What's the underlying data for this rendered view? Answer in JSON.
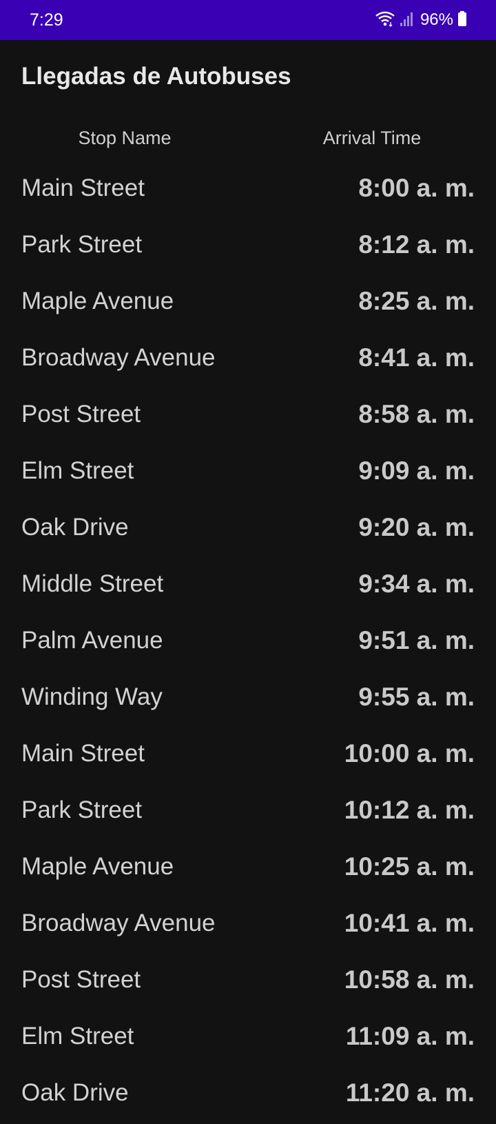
{
  "status_bar": {
    "time": "7:29",
    "battery": "96%",
    "icons": [
      "wifi-icon",
      "signal-icon",
      "battery-icon"
    ]
  },
  "app_bar": {
    "title": "Llegadas de Autobuses"
  },
  "table": {
    "headers": {
      "stop": "Stop Name",
      "arrival": "Arrival Time"
    },
    "rows": [
      {
        "stop": "Main Street",
        "time": "8:00 a. m."
      },
      {
        "stop": "Park Street",
        "time": "8:12 a. m."
      },
      {
        "stop": "Maple Avenue",
        "time": "8:25 a. m."
      },
      {
        "stop": "Broadway Avenue",
        "time": "8:41 a. m."
      },
      {
        "stop": "Post Street",
        "time": "8:58 a. m."
      },
      {
        "stop": "Elm Street",
        "time": "9:09 a. m."
      },
      {
        "stop": "Oak Drive",
        "time": "9:20 a. m."
      },
      {
        "stop": "Middle Street",
        "time": "9:34 a. m."
      },
      {
        "stop": "Palm Avenue",
        "time": "9:51 a. m."
      },
      {
        "stop": "Winding Way",
        "time": "9:55 a. m."
      },
      {
        "stop": "Main Street",
        "time": "10:00 a. m."
      },
      {
        "stop": "Park Street",
        "time": "10:12 a. m."
      },
      {
        "stop": "Maple Avenue",
        "time": "10:25 a. m."
      },
      {
        "stop": "Broadway Avenue",
        "time": "10:41 a. m."
      },
      {
        "stop": "Post Street",
        "time": "10:58 a. m."
      },
      {
        "stop": "Elm Street",
        "time": "11:09 a. m."
      },
      {
        "stop": "Oak Drive",
        "time": "11:20 a. m."
      }
    ]
  },
  "colors": {
    "status_bar": "#3a00b4",
    "background": "#121212",
    "text": "#d2d2d2"
  }
}
